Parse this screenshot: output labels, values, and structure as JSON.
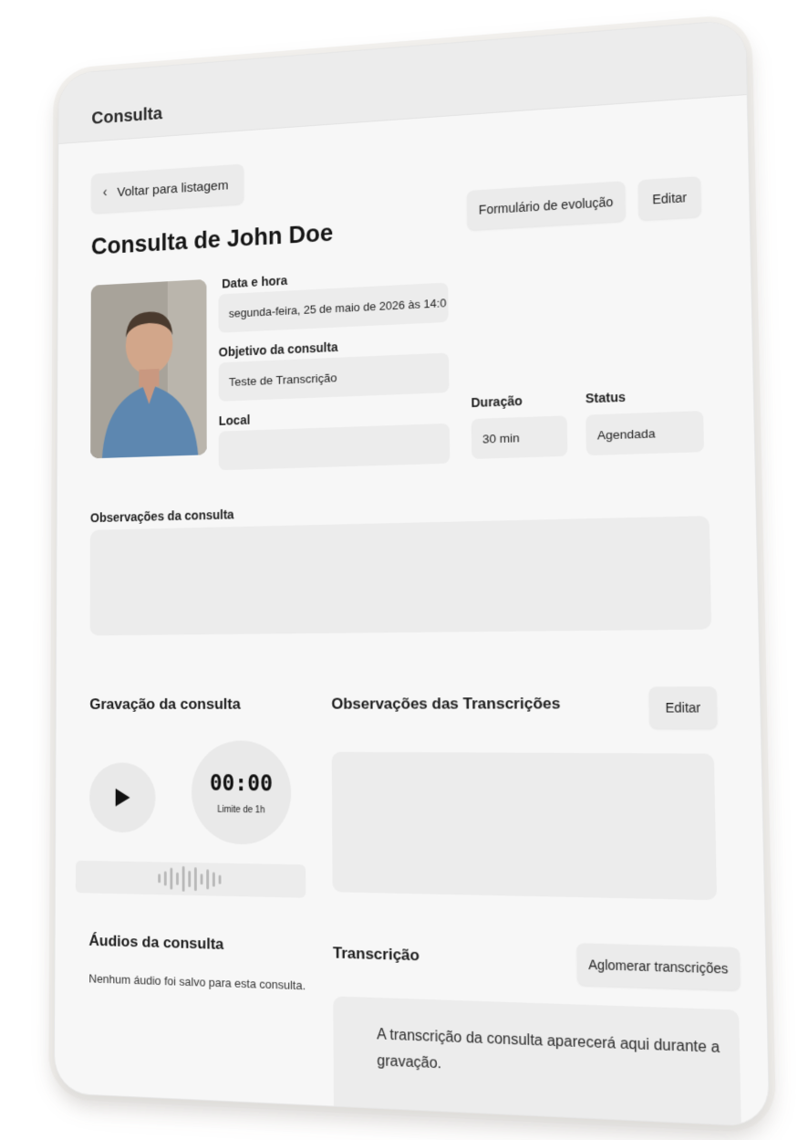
{
  "header": {
    "title": "Consulta"
  },
  "back_button": {
    "label": "Voltar para listagem"
  },
  "actions": {
    "form_label": "Formulário de evolução",
    "edit_label": "Editar"
  },
  "page_title": "Consulta de John Doe",
  "fields": {
    "datetime_label": "Data e hora",
    "datetime_value": "segunda-feira, 25 de maio de 2026 às 14:0",
    "objective_label": "Objetivo da consulta",
    "objective_value": "Teste de Transcrição",
    "location_label": "Local",
    "location_value": "",
    "duration_label": "Duração",
    "duration_value": "30 min",
    "status_label": "Status",
    "status_value": "Agendada"
  },
  "notes": {
    "label": "Observações da consulta",
    "value": ""
  },
  "recording": {
    "title": "Gravação da consulta",
    "timer": "00:00",
    "limit": "Limite de 1h"
  },
  "transcription_notes": {
    "title": "Observações das Transcrições",
    "edit_label": "Editar",
    "value": ""
  },
  "audios": {
    "title": "Áudios da consulta",
    "empty_text": "Nenhum áudio foi salvo para esta consulta."
  },
  "transcription": {
    "title": "Transcrição",
    "merge_label": "Aglomerar transcrições",
    "placeholder": "A transcrição da consulta aparecerá aqui durante a gravação."
  },
  "icons": {
    "back": "chevron-left-icon",
    "play": "play-icon",
    "waveform": "waveform-icon"
  }
}
